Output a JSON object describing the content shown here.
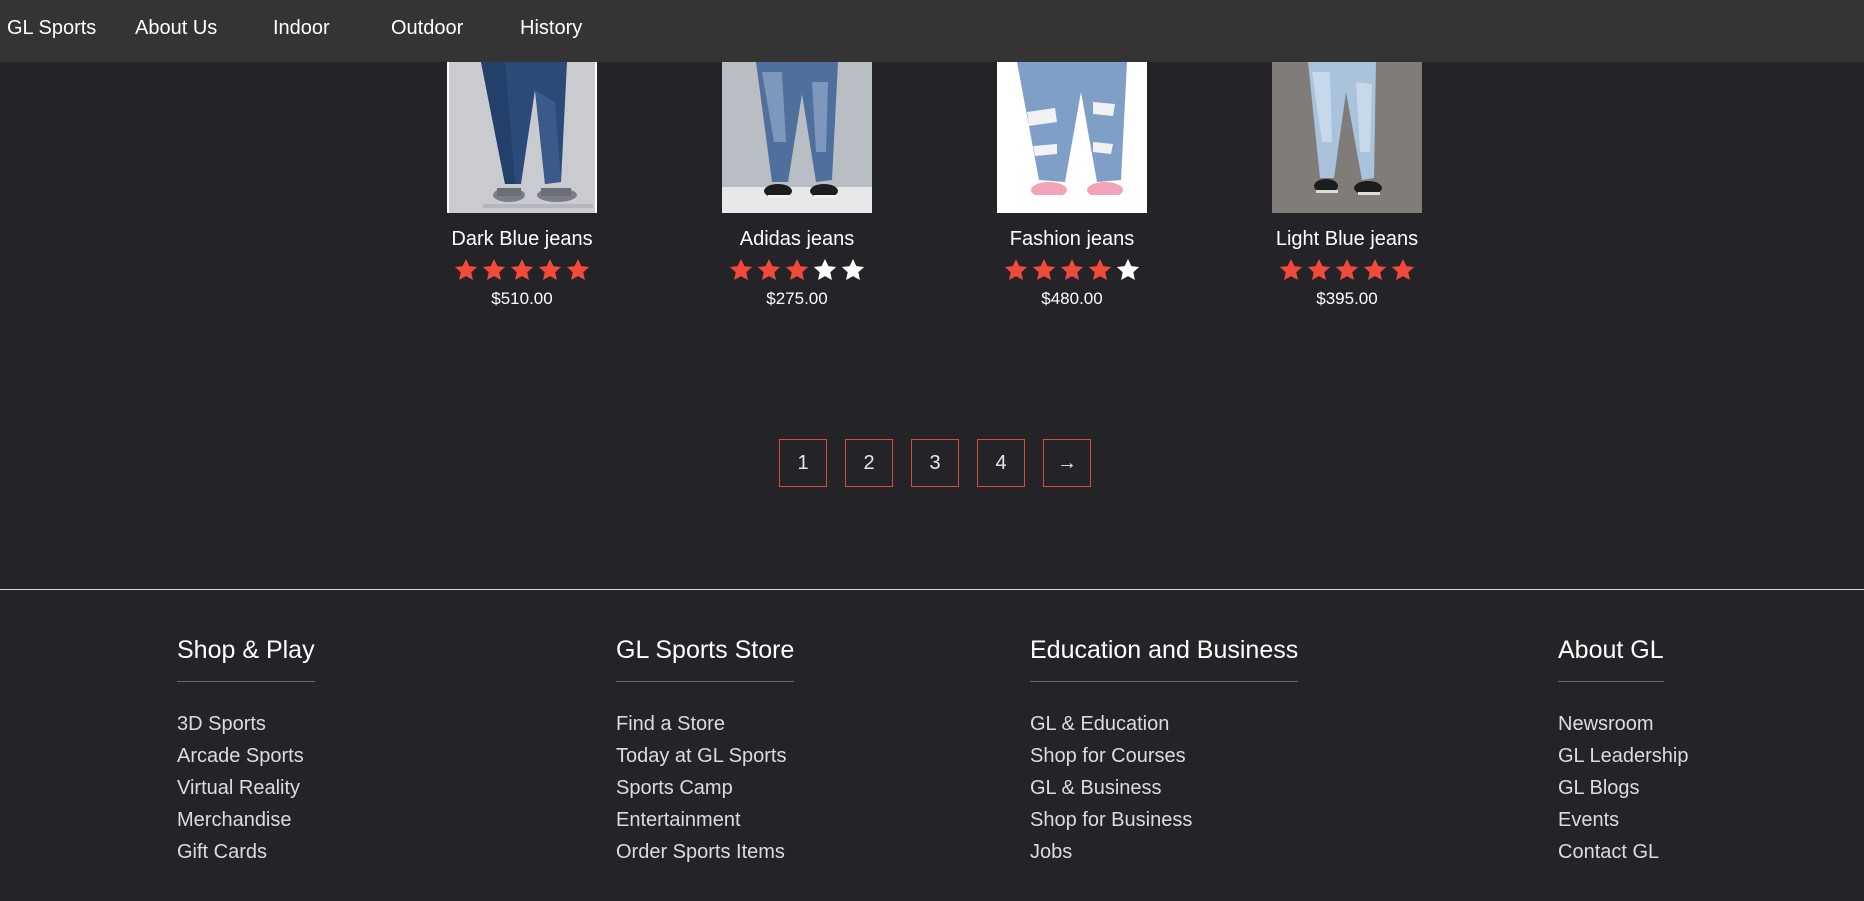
{
  "nav": {
    "brand": "GL Sports",
    "items": [
      {
        "label": "About Us"
      },
      {
        "label": "Indoor"
      },
      {
        "label": "Outdoor"
      },
      {
        "label": "History"
      }
    ]
  },
  "products": [
    {
      "name": "Dark Blue jeans",
      "rating": 5,
      "rating_max": 5,
      "price": "$510.00",
      "image_icon": "dark-blue-jeans-image"
    },
    {
      "name": "Adidas jeans",
      "rating": 3,
      "rating_max": 5,
      "price": "$275.00",
      "image_icon": "adidas-jeans-image"
    },
    {
      "name": "Fashion jeans",
      "rating": 4,
      "rating_max": 5,
      "price": "$480.00",
      "image_icon": "fashion-jeans-image"
    },
    {
      "name": "Light Blue jeans",
      "rating": 5,
      "rating_max": 5,
      "price": "$395.00",
      "image_icon": "light-blue-jeans-image"
    }
  ],
  "pagination": {
    "pages": [
      "1",
      "2",
      "3",
      "4"
    ],
    "next_label": "→"
  },
  "footer": {
    "columns": [
      {
        "heading": "Shop & Play",
        "links": [
          "3D Sports",
          "Arcade Sports",
          "Virtual Reality",
          "Merchandise",
          "Gift Cards"
        ]
      },
      {
        "heading": "GL Sports Store",
        "links": [
          "Find a Store",
          "Today at GL Sports",
          "Sports Camp",
          "Entertainment",
          "Order Sports Items"
        ]
      },
      {
        "heading": "Education and Business",
        "links": [
          "GL & Education",
          "Shop for Courses",
          "GL & Business",
          "Shop for Business",
          "Jobs"
        ]
      },
      {
        "heading": "About GL",
        "links": [
          "Newsroom",
          "GL Leadership",
          "GL Blogs",
          "Events",
          "Contact GL"
        ]
      }
    ]
  },
  "colors": {
    "page_bg": "#242428",
    "nav_bg": "#343434",
    "star_filled": "#f04a3a",
    "star_empty": "#ffffff",
    "page_border": "#d84a3a"
  }
}
